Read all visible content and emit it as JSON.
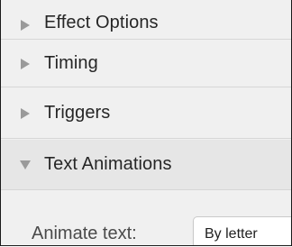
{
  "sections": [
    {
      "label": "Effect Options",
      "expanded": false,
      "icon": "chevron-right-icon"
    },
    {
      "label": "Timing",
      "expanded": false,
      "icon": "chevron-right-icon"
    },
    {
      "label": "Triggers",
      "expanded": false,
      "icon": "chevron-right-icon"
    },
    {
      "label": "Text Animations",
      "expanded": true,
      "icon": "chevron-down-icon"
    }
  ],
  "text_animations": {
    "animate_text_label": "Animate text:",
    "animate_text_value": "By letter"
  },
  "colors": {
    "header_text": "#262626",
    "chevron": "#9a9a9a",
    "panel_bg": "#f0f0f0",
    "expanded_header_bg": "#e6e6e6"
  }
}
